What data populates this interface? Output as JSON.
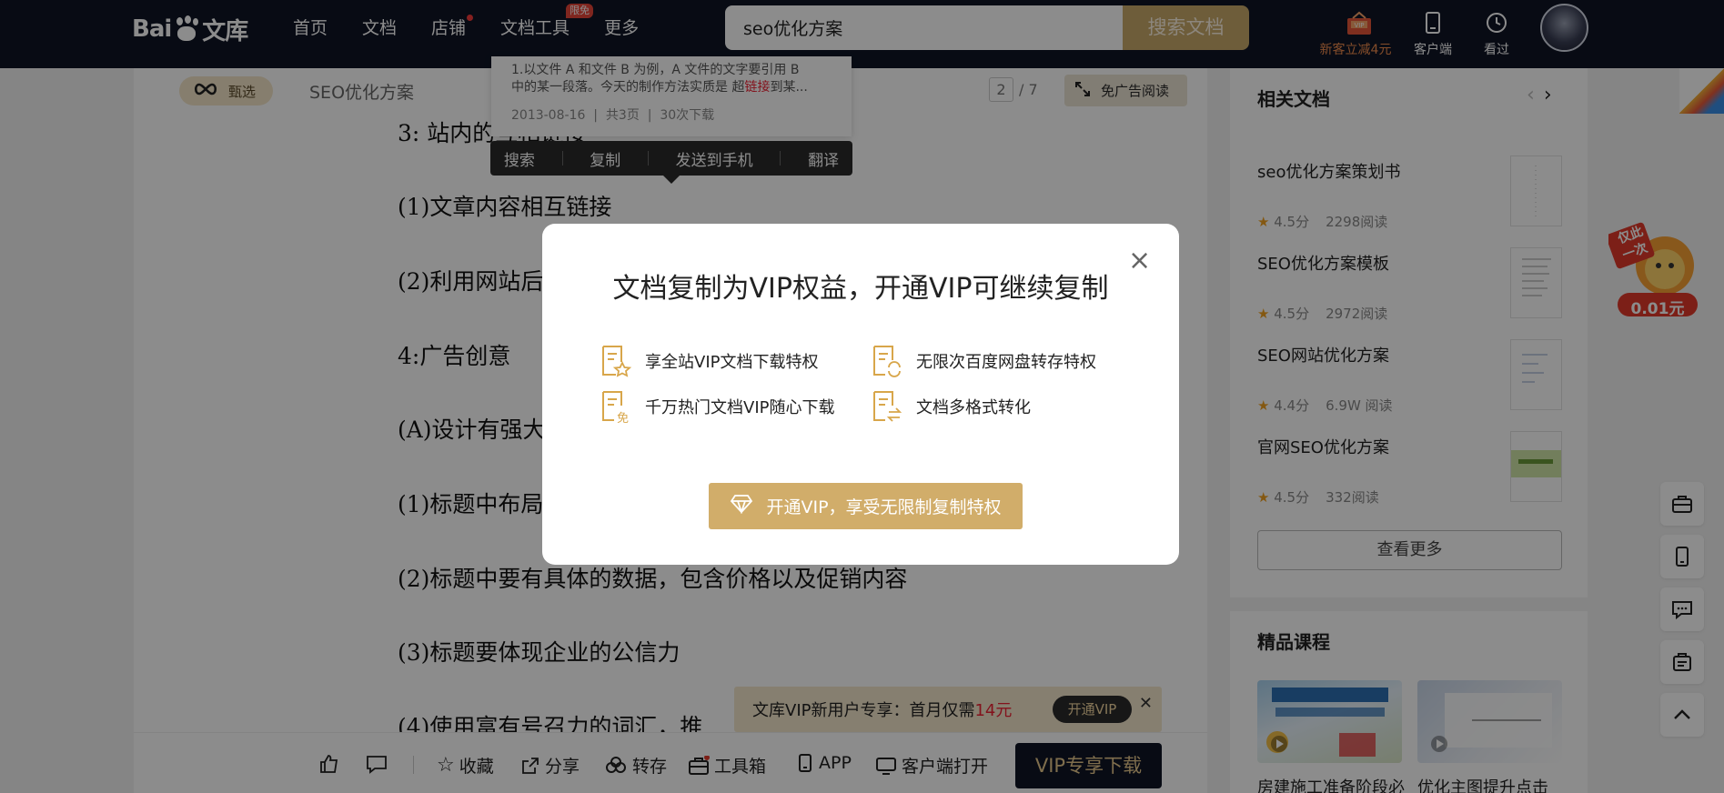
{
  "header": {
    "logo_text_left": "Bai",
    "logo_text_right": "文库",
    "nav": [
      "首页",
      "文档",
      "店铺",
      "文档工具",
      "更多"
    ],
    "nav_badge": "限免",
    "search_value": "seo优化方案",
    "search_button": "搜索文档",
    "vip_promo": "新客立减4元",
    "client": "客户端",
    "seen": "看过"
  },
  "doc": {
    "featured": "甄选",
    "title": "SEO优化方案",
    "page_current": "2",
    "page_total": "/ 7",
    "ad_free": "免广告阅读",
    "paragraphs": [
      "3:  站内的互相链接",
      "(1)文章内容相互链接",
      "(2)利用网站后",
      "4:广告创意",
      "(A)设计有强大",
      "(1)标题中布局",
      "(2)标题中要有具体的数据，包含价格以及促销内容",
      "(3)标题要体现企业的公信力",
      "(4)使用富有号召力的词汇，推"
    ]
  },
  "preview": {
    "snippet_line1": "1.以文件 A 和文件 B 为例，A 文件的文字要引用 B",
    "snippet_line2_a": "中的某一段落。今天的制作方法实质是 超",
    "snippet_line2_b": "链接",
    "snippet_line2_c": "到某...",
    "date": "2013-08-16",
    "pages": "共3页",
    "downloads": "30次下载"
  },
  "context_menu": [
    "搜索",
    "复制",
    "发送到手机",
    "翻译"
  ],
  "related": {
    "title": "相关文档",
    "items": [
      {
        "name": "seo优化方案策划书",
        "score": "4.5分",
        "reads": "2298阅读"
      },
      {
        "name": "SEO优化方案模板",
        "score": "4.5分",
        "reads": "2972阅读"
      },
      {
        "name": "SEO网站优化方案",
        "score": "4.4分",
        "reads": "6.9W 阅读"
      },
      {
        "name": "官网SEO优化方案",
        "score": "4.5分",
        "reads": "332阅读"
      }
    ],
    "see_more": "查看更多"
  },
  "courses": {
    "title": "精品课程",
    "items": [
      {
        "name": "房建施工准备阶段必"
      },
      {
        "name": "优化主图提升点击"
      }
    ]
  },
  "promo_sticker": {
    "line1": "仅此",
    "line2": "一次",
    "price": "0.01元"
  },
  "bottom_bar": {
    "favorite": "收藏",
    "share": "分享",
    "transfer": "转存",
    "toolbox": "工具箱",
    "app": "APP",
    "client_open": "客户端打开",
    "vip_download": "VIP专享下载"
  },
  "vip_banner": {
    "text": "文库VIP新用户专享：首月仅需",
    "price": "14元",
    "button": "开通VIP"
  },
  "modal": {
    "title": "文档复制为VIP权益，开通VIP可继续复制",
    "perks": [
      "享全站VIP文档下载特权",
      "无限次百度网盘转存特权",
      "千万热门文档VIP随心下载",
      "文档多格式转化"
    ],
    "cta": "开通VIP，享受无限制复制特权"
  },
  "colors": {
    "nav_bg": "#0f1526",
    "gold": "#c8a96a",
    "accent_red": "#e7453a"
  }
}
